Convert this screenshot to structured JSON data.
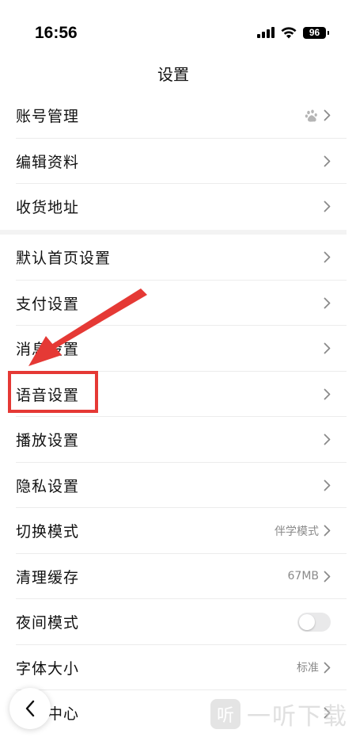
{
  "status_bar": {
    "time": "16:56",
    "battery": "96",
    "icons": [
      "signal-icon",
      "wifi-icon",
      "battery-icon"
    ]
  },
  "nav": {
    "title": "设置"
  },
  "groups": [
    {
      "items": [
        {
          "label": "账号管理",
          "icon": "baidu-paw-icon"
        },
        {
          "label": "编辑资料"
        },
        {
          "label": "收货地址"
        }
      ]
    },
    {
      "items": [
        {
          "label": "默认首页设置"
        },
        {
          "label": "支付设置"
        },
        {
          "label": "消息设置"
        },
        {
          "label": "语音设置"
        },
        {
          "label": "播放设置"
        },
        {
          "label": "隐私设置"
        },
        {
          "label": "切换模式",
          "value": "伴学模式"
        },
        {
          "label": "清理缓存",
          "value": "67MB"
        },
        {
          "label": "夜间模式",
          "toggle": false
        },
        {
          "label": "字体大小",
          "value": "标准"
        },
        {
          "label": "帮助中心"
        }
      ]
    }
  ],
  "colors": {
    "annotation": "#e53935",
    "divider": "#ececec",
    "secondary_text": "#8a8a8a"
  },
  "watermark": {
    "logo_glyph": "听",
    "text": "一听下载"
  }
}
